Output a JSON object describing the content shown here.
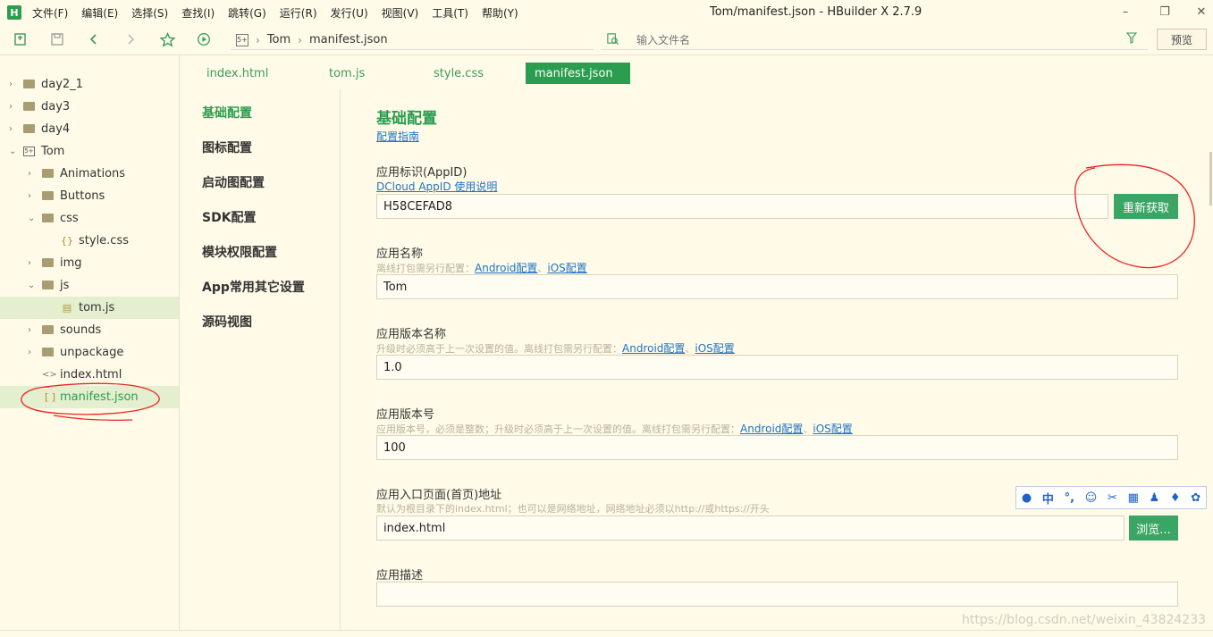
{
  "titlebar": {
    "logo": "H",
    "menu": [
      "文件(F)",
      "编辑(E)",
      "选择(S)",
      "查找(I)",
      "跳转(G)",
      "运行(R)",
      "发行(U)",
      "视图(V)",
      "工具(T)",
      "帮助(Y)"
    ],
    "window_title": "Tom/manifest.json - HBuilder X 2.7.9",
    "minimize": "–",
    "maximize": "❐",
    "close": "✕"
  },
  "toolbar": {
    "new_icon": "new-file-icon",
    "save_icon": "save-icon",
    "back_icon": "chevron-left-icon",
    "forward_icon": "chevron-right-icon",
    "star_icon": "star-icon",
    "run_icon": "run-icon",
    "crumb_logo": "5+",
    "crumb_project": "Tom",
    "crumb_file": "manifest.json",
    "search_placeholder": "输入文件名",
    "preview_label": "预览"
  },
  "sidebar": {
    "items": [
      {
        "label": "day2_1",
        "type": "folder",
        "depth": 0,
        "arrow": "›"
      },
      {
        "label": "day3",
        "type": "folder",
        "depth": 0,
        "arrow": "›"
      },
      {
        "label": "day4",
        "type": "folder",
        "depth": 0,
        "arrow": "›"
      },
      {
        "label": "Tom",
        "type": "project",
        "depth": 0,
        "arrow": "⌄"
      },
      {
        "label": "Animations",
        "type": "folder",
        "depth": 1,
        "arrow": "›"
      },
      {
        "label": "Buttons",
        "type": "folder",
        "depth": 1,
        "arrow": "›"
      },
      {
        "label": "css",
        "type": "folder",
        "depth": 1,
        "arrow": "⌄"
      },
      {
        "label": "style.css",
        "type": "css",
        "depth": 2,
        "arrow": ""
      },
      {
        "label": "img",
        "type": "folder",
        "depth": 1,
        "arrow": "›"
      },
      {
        "label": "js",
        "type": "folder",
        "depth": 1,
        "arrow": "⌄"
      },
      {
        "label": "tom.js",
        "type": "js",
        "depth": 2,
        "arrow": ""
      },
      {
        "label": "sounds",
        "type": "folder",
        "depth": 1,
        "arrow": "›"
      },
      {
        "label": "unpackage",
        "type": "folder",
        "depth": 1,
        "arrow": "›"
      },
      {
        "label": "index.html",
        "type": "html",
        "depth": 1,
        "arrow": ""
      },
      {
        "label": "manifest.json",
        "type": "json",
        "depth": 1,
        "arrow": ""
      }
    ]
  },
  "tabs": [
    "index.html",
    "tom.js",
    "style.css",
    "manifest.json"
  ],
  "settings_nav": [
    "基础配置",
    "图标配置",
    "启动图配置",
    "SDK配置",
    "模块权限配置",
    "App常用其它设置",
    "源码视图"
  ],
  "form": {
    "title": "基础配置",
    "guide_link": "配置指南",
    "appid": {
      "label": "应用标识(AppID)",
      "link": "DCloud AppID 使用说明",
      "value": "H58CEFAD8",
      "button": "重新获取"
    },
    "app_name": {
      "label": "应用名称",
      "hint": "离线打包需另行配置：",
      "link_android": "Android配置",
      "sep": "、",
      "link_ios": "iOS配置",
      "value": "Tom"
    },
    "version_name": {
      "label": "应用版本名称",
      "hint": "升级时必须高于上一次设置的值。离线打包需另行配置：",
      "link_android": "Android配置",
      "sep": "、",
      "link_ios": "iOS配置",
      "value": "1.0"
    },
    "version_code": {
      "label": "应用版本号",
      "hint": "应用版本号，必须是整数；升级时必须高于上一次设置的值。离线打包需另行配置：",
      "link_android": "Android配置",
      "sep": "、",
      "link_ios": "iOS配置",
      "value": "100"
    },
    "entry": {
      "label": "应用入口页面(首页)地址",
      "hint": "默认为根目录下的index.html；也可以是网络地址，网络地址必须以http://或https://开头",
      "value": "index.html",
      "button": "浏览..."
    },
    "desc": {
      "label": "应用描述",
      "value": ""
    }
  },
  "ime": {
    "icons": [
      "ime-logo-icon",
      "chinese-mode-icon",
      "punctuation-icon",
      "emoji-icon",
      "scissors-icon",
      "keyboard-icon",
      "user-icon",
      "skin-icon",
      "settings-icon"
    ],
    "glyphs": [
      "●",
      "中",
      "°,",
      "☺",
      "✂",
      "▦",
      "♟",
      "♦",
      "✿"
    ]
  },
  "watermark": "https://blog.csdn.net/weixin_43824233"
}
